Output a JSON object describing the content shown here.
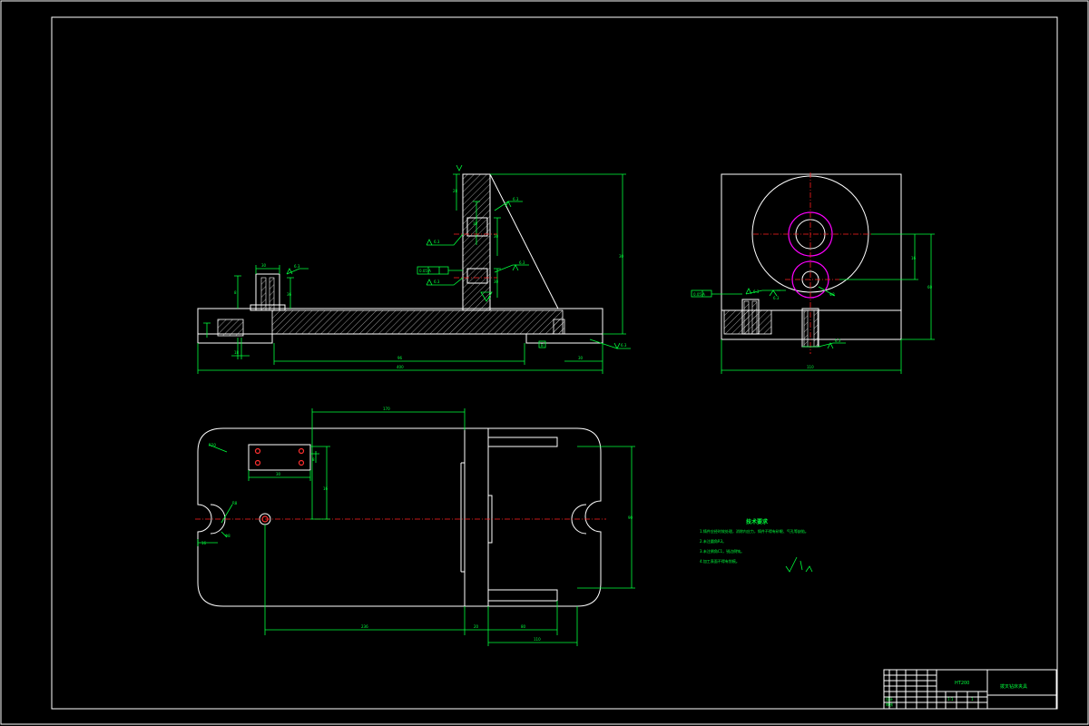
{
  "sheet": {
    "background": "#000000",
    "line_colors": {
      "outline": "#ffffff",
      "dimension": "#00ff3c",
      "centerline": "#ff2020",
      "hidden_circle": "#ff00ff"
    }
  },
  "front_view": {
    "dims": {
      "top_height": "28",
      "boss_h": "8",
      "boss_a": "36",
      "boss_b": "30",
      "overall_h": "30",
      "vert_a": "30",
      "vert_b": "30",
      "vert_c": "30",
      "bottom_span": "96",
      "total_len": "400",
      "right_seg": "30",
      "left_small": "18"
    },
    "roughness": {
      "r1": "6.3",
      "r2": "6.3",
      "r3": "6.3",
      "r4": "6.3",
      "r5": "6.3"
    },
    "tol_frame": "0.05 A",
    "datum": "A",
    "datum_b": "B"
  },
  "side_view": {
    "dims": {
      "h1": "16",
      "h2": "60",
      "width": "110",
      "dia": "Φ8"
    },
    "roughness": {
      "r1": "6.3",
      "r2": "6.3",
      "r3": "6.3"
    },
    "tol_frame": "0.05 A"
  },
  "top_view": {
    "dims": {
      "top_len": "170",
      "vert_1": "16",
      "vert_2": "8",
      "left_small": "16",
      "notch_r": "R8",
      "corner_r": "R20",
      "hole_dia": "Φ8",
      "right_h": "90",
      "bottom_1": "236",
      "bottom_2": "20",
      "bottom_3": "80",
      "bottom_4": "110",
      "small_a": "30",
      "small_b": "30"
    }
  },
  "tech_notes": {
    "heading": "技术要求",
    "lines": [
      "1.铸件应经时效处理，消除内应力，铸件不得有砂眼、气孔等缺陷。",
      "2.未注圆角R3。",
      "3.未注倒角C1，锐边倒钝。",
      "4.加工表面不得有划痕。"
    ],
    "roughness_symbol": "√(√)"
  },
  "title_block": {
    "part_name": "拨叉钻床夹具",
    "material": "HT200",
    "scale": "1:1",
    "sheet": "1",
    "designer": "设计",
    "checker": "审核"
  }
}
